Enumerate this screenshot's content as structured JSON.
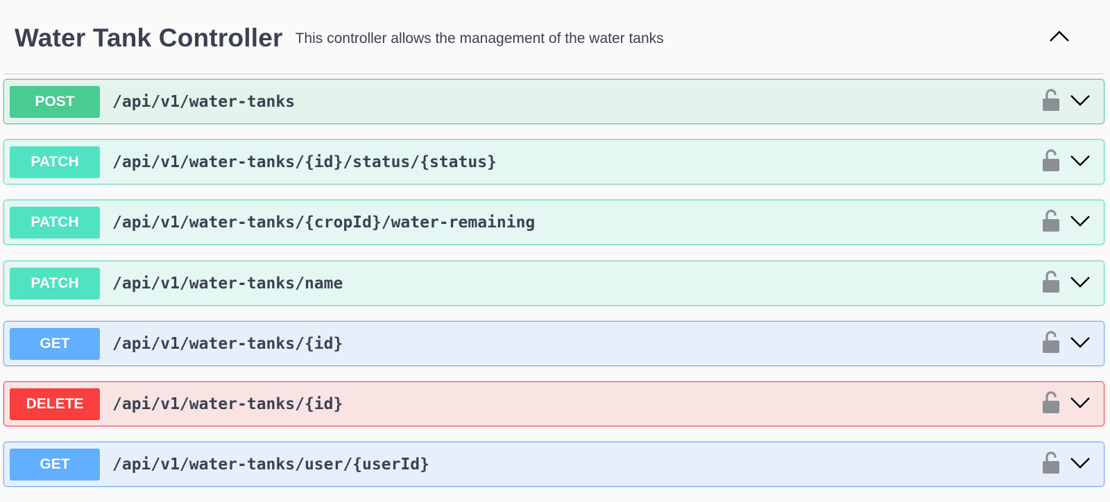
{
  "tag": {
    "title": "Water Tank Controller",
    "description": "This controller allows the management of the water tanks",
    "collapse_icon": "chevron-up-icon"
  },
  "operations": [
    {
      "method": "POST",
      "path": "/api/v1/water-tanks",
      "color": "#49cc90",
      "lock_icon": "unlocked-padlock-icon",
      "expand_icon": "chevron-down-icon"
    },
    {
      "method": "PATCH",
      "path": "/api/v1/water-tanks/{id}/status/{status}",
      "color": "#50e3c2",
      "lock_icon": "unlocked-padlock-icon",
      "expand_icon": "chevron-down-icon"
    },
    {
      "method": "PATCH",
      "path": "/api/v1/water-tanks/{cropId}/water-remaining",
      "color": "#50e3c2",
      "lock_icon": "unlocked-padlock-icon",
      "expand_icon": "chevron-down-icon"
    },
    {
      "method": "PATCH",
      "path": "/api/v1/water-tanks/name",
      "color": "#50e3c2",
      "lock_icon": "unlocked-padlock-icon",
      "expand_icon": "chevron-down-icon"
    },
    {
      "method": "GET",
      "path": "/api/v1/water-tanks/{id}",
      "color": "#61affe",
      "lock_icon": "unlocked-padlock-icon",
      "expand_icon": "chevron-down-icon"
    },
    {
      "method": "DELETE",
      "path": "/api/v1/water-tanks/{id}",
      "color": "#f93e3e",
      "lock_icon": "unlocked-padlock-icon",
      "expand_icon": "chevron-down-icon"
    },
    {
      "method": "GET",
      "path": "/api/v1/water-tanks/user/{userId}",
      "color": "#61affe",
      "lock_icon": "unlocked-padlock-icon",
      "expand_icon": "chevron-down-icon"
    }
  ]
}
